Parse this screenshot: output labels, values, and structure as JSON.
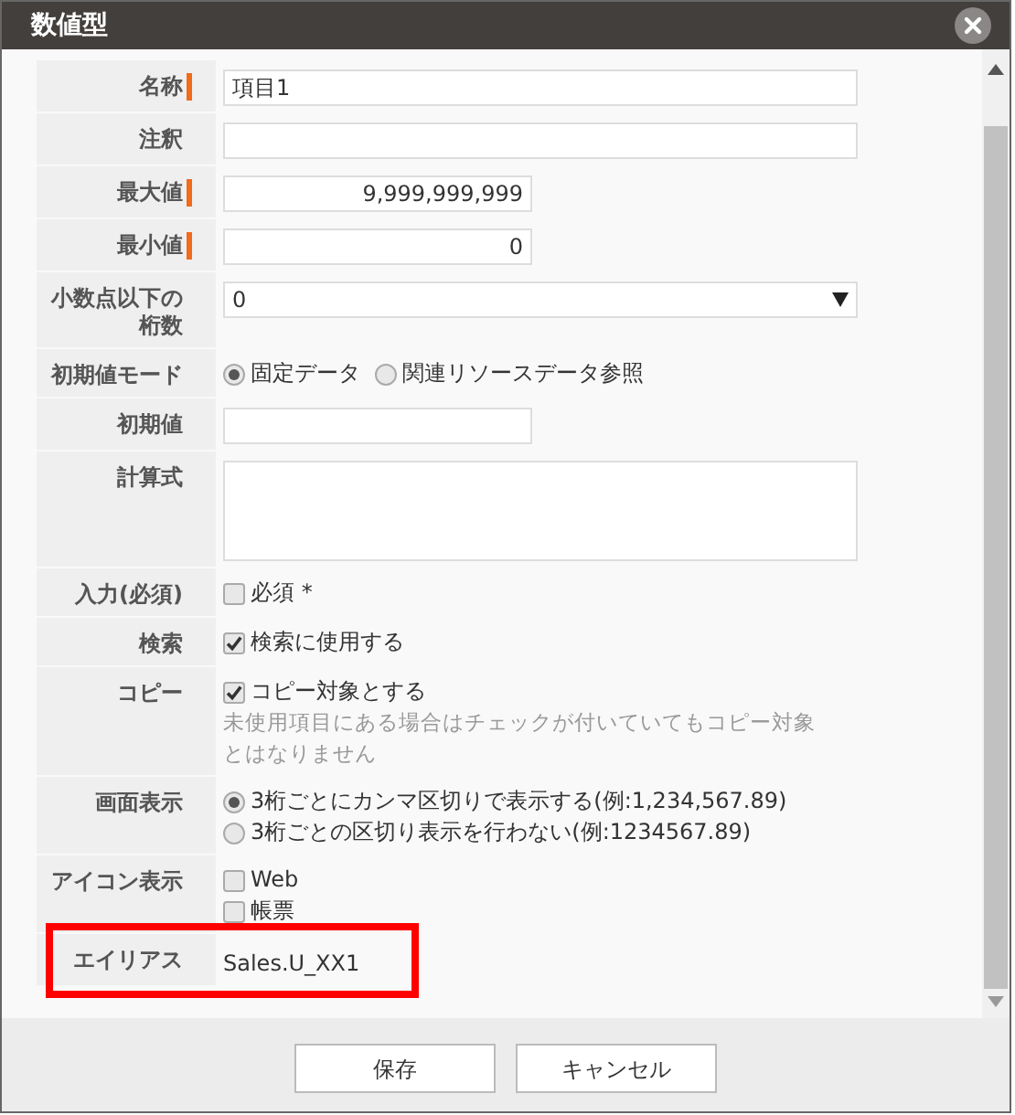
{
  "dialog": {
    "title": "数値型"
  },
  "fields": [
    {
      "label": "名称",
      "required": true,
      "highlighted": false,
      "kind": "text",
      "value": "項目1"
    },
    {
      "label": "注釈",
      "required": false,
      "highlighted": false,
      "kind": "text"
    },
    {
      "label": "最大値",
      "required": true,
      "highlighted": false,
      "kind": "number",
      "value": "9,999,999,999"
    },
    {
      "label": "最小値",
      "required": true,
      "highlighted": false,
      "kind": "number",
      "value": "0"
    },
    {
      "label": "小数点以下の桁数",
      "required": false,
      "highlighted": false,
      "kind": "select",
      "value": "0"
    },
    {
      "label": "初期値モード",
      "required": false,
      "highlighted": false,
      "kind": "radio-inline",
      "options": [
        {
          "label": "固定データ",
          "selected": true
        },
        {
          "label": "関連リソースデータ参照",
          "selected": false
        }
      ]
    },
    {
      "label": "初期値",
      "required": false,
      "highlighted": false,
      "kind": "number"
    },
    {
      "label": "計算式",
      "required": false,
      "highlighted": false,
      "kind": "textarea"
    },
    {
      "label": "入力(必須)",
      "required": false,
      "highlighted": false,
      "kind": "checkbox",
      "options": [
        {
          "label": "必須 *",
          "checked": false
        }
      ]
    },
    {
      "label": "検索",
      "required": false,
      "highlighted": false,
      "kind": "checkbox",
      "options": [
        {
          "label": "検索に使用する",
          "checked": true
        }
      ]
    },
    {
      "label": "コピー",
      "required": false,
      "highlighted": false,
      "kind": "checkbox",
      "options": [
        {
          "label": "コピー対象とする",
          "checked": true
        }
      ],
      "note": "未使用項目にある場合はチェックが付いていてもコピー対象とはなりません"
    },
    {
      "label": "画面表示",
      "required": false,
      "highlighted": false,
      "kind": "radio-list",
      "options": [
        {
          "label": "3桁ごとにカンマ区切りで表示する(例:1,234,567.89)",
          "selected": true
        },
        {
          "label": "3桁ごとの区切り表示を行わない(例:1234567.89)",
          "selected": false
        }
      ]
    },
    {
      "label": "アイコン表示",
      "required": false,
      "highlighted": false,
      "kind": "checkbox",
      "options": [
        {
          "label": "Web",
          "checked": false
        },
        {
          "label": "帳票",
          "checked": false
        }
      ]
    },
    {
      "label": "エイリアス",
      "required": false,
      "highlighted": true,
      "kind": "static",
      "value": "Sales.U_XX1"
    }
  ],
  "buttons": [
    {
      "label": "保存"
    },
    {
      "label": "キャンセル"
    }
  ]
}
